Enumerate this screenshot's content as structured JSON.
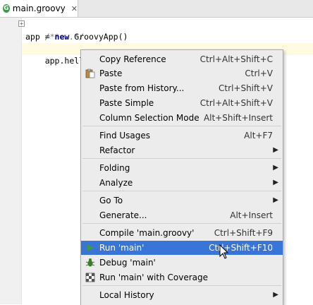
{
  "tab": {
    "icon_letter": "G",
    "label": "main.groovy",
    "close": "✕"
  },
  "editor": {
    "lines": [
      {
        "text": "/**...*/"
      },
      {
        "prefix": "app = ",
        "keyword": "new",
        "suffix": " GroovyApp()"
      },
      {
        "text": "app.hello()"
      }
    ]
  },
  "menu": {
    "items": [
      {
        "label": "Copy Reference",
        "shortcut": "Ctrl+Alt+Shift+C"
      },
      {
        "label": "Paste",
        "shortcut": "Ctrl+V",
        "icon": "clipboard-icon"
      },
      {
        "label": "Paste from History...",
        "shortcut": "Ctrl+Shift+V"
      },
      {
        "label": "Paste Simple",
        "shortcut": "Ctrl+Alt+Shift+V"
      },
      {
        "label": "Column Selection Mode",
        "shortcut": "Alt+Shift+Insert"
      },
      {
        "label": "Find Usages",
        "shortcut": "Alt+F7"
      },
      {
        "label": "Refactor",
        "submenu": true
      },
      {
        "label": "Folding",
        "submenu": true
      },
      {
        "label": "Analyze",
        "submenu": true
      },
      {
        "label": "Go To",
        "submenu": true
      },
      {
        "label": "Generate...",
        "shortcut": "Alt+Insert"
      },
      {
        "label": "Compile 'main.groovy'",
        "shortcut": "Ctrl+Shift+F9"
      },
      {
        "label": "Run 'main'",
        "shortcut": "Ctrl+Shift+F10",
        "icon": "run-icon",
        "selected": true
      },
      {
        "label": "Debug 'main'",
        "icon": "debug-icon"
      },
      {
        "label": "Run 'main' with Coverage",
        "icon": "coverage-icon"
      },
      {
        "label": "Local History",
        "submenu": true
      }
    ],
    "submenu_arrow": "▶"
  },
  "colors": {
    "selection": "#3875d7",
    "menu_bg": "#ececec",
    "run_green": "#3c9a45"
  }
}
